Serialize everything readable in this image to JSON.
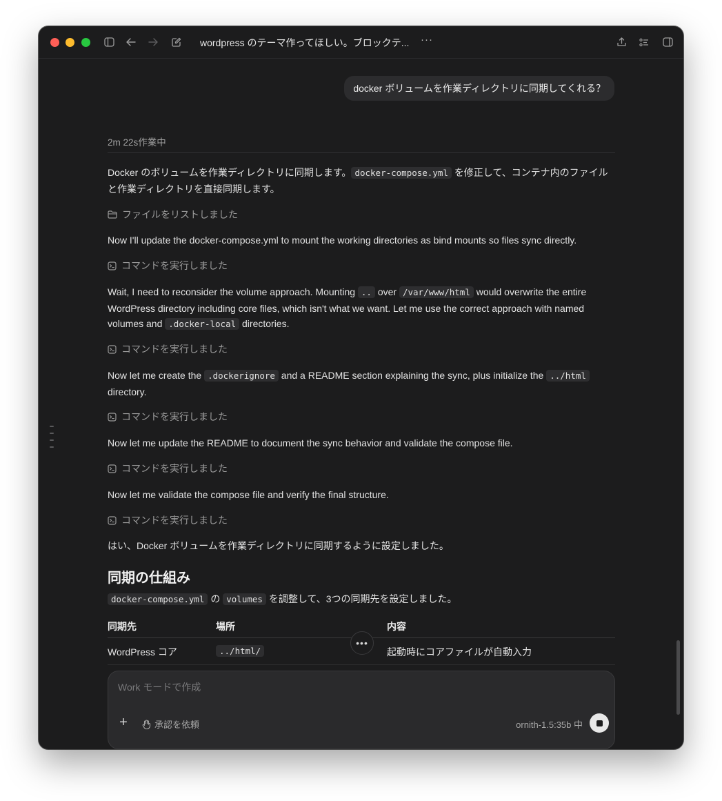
{
  "window": {
    "title": "wordpress のテーマ作ってほしい。ブロックテ...",
    "more": "···"
  },
  "user_message": "docker ボリュームを作業ディレクトリに同期してくれる？",
  "assistant": {
    "work_time": "2m 22s作業中",
    "p1": {
      "a": "Docker のボリュームを作業ディレクトリに同期します。",
      "code1": "docker-compose.yml",
      "b": " を修正して、コンテナ内のファイルと作業ディレクトリを直接同期します。"
    },
    "step_list_files": "ファイルをリストしました",
    "p2": "Now I'll update the docker-compose.yml to mount the working directories as bind mounts so files sync directly.",
    "step_cmd": "コマンドを実行しました",
    "p3": {
      "a": "Wait, I need to reconsider the volume approach. Mounting ",
      "code1": "..",
      "b": " over ",
      "code2": "/var/www/html",
      "c": " would overwrite the entire WordPress directory including core files, which isn't what we want. Let me use the correct approach with named volumes and ",
      "code3": ".docker-local",
      "d": " directories."
    },
    "p4": {
      "a": "Now let me create the ",
      "code1": ".dockerignore",
      "b": " and a README section explaining the sync, plus initialize the ",
      "code2": "../html",
      "c": " directory."
    },
    "p5": "Now let me update the README to document the sync behavior and validate the compose file.",
    "p6": "Now let me validate the compose file and verify the final structure.",
    "p7": "はい、Docker ボリュームを作業ディレクトリに同期するように設定しました。",
    "heading": "同期の仕組み",
    "p8": {
      "code1": "docker-compose.yml",
      "a": " の ",
      "code2": "volumes",
      "b": " を調整して、3つの同期先を設定しました。"
    },
    "table": {
      "headers": [
        "同期先",
        "場所",
        "内容"
      ],
      "rows": [
        [
          "WordPress コア",
          "../html/",
          "起動時にコアファイルが自動入力"
        ]
      ]
    }
  },
  "composer": {
    "placeholder": "Work モードで作成",
    "plus": "+",
    "approve_label": "承認を依頼",
    "model": "ornith-1.5:35b 中"
  }
}
